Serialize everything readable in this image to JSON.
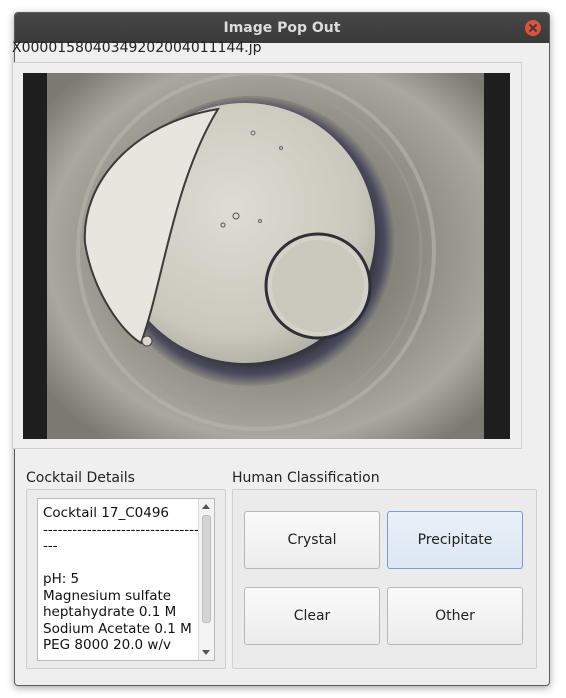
{
  "window": {
    "title": "Image Pop Out"
  },
  "image": {
    "filename": "X0000158040349202004011144.jp"
  },
  "cocktail": {
    "heading": "Cocktail Details",
    "lines": [
      "Cocktail 17_C0496",
      "---------------------------------",
      "---",
      "",
      "pH: 5",
      "Magnesium sulfate",
      "heptahydrate 0.1 M",
      "Sodium Acetate 0.1 M",
      "PEG 8000 20.0 w/v"
    ]
  },
  "classification": {
    "heading": "Human Classification",
    "buttons": {
      "crystal": "Crystal",
      "precipitate": "Precipitate",
      "clear": "Clear",
      "other": "Other"
    },
    "selected": "precipitate"
  }
}
